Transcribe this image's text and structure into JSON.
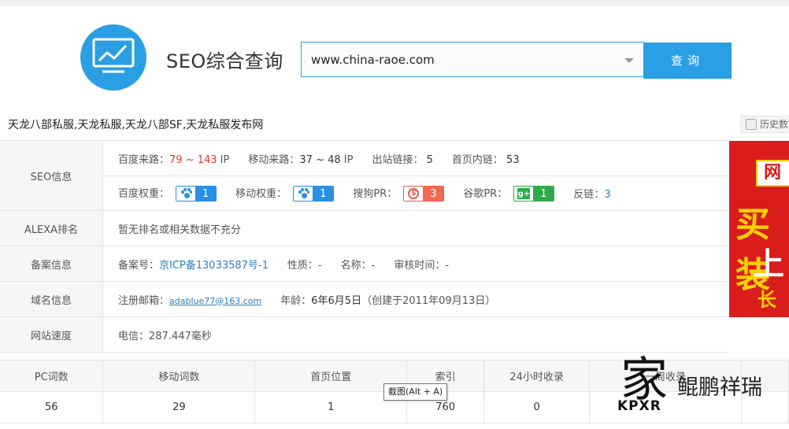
{
  "header": {
    "brand": "SEO综合查询",
    "search_value": "www.china-raoe.com",
    "search_button": "查询"
  },
  "site_title": "天龙八部私服,天龙私服,天龙八部SF,天龙私服发布网",
  "history_label": "历史数",
  "seo": {
    "label": "SEO信息",
    "baidu_traffic_label": "百度来路：",
    "baidu_traffic_value": "79 ~ 143",
    "baidu_traffic_unit": "IP",
    "mobile_traffic_label": "移动来路：",
    "mobile_traffic_value": "37 ~ 48",
    "mobile_traffic_unit": "IP",
    "outbound_label": "出站链接：",
    "outbound_value": "5",
    "internal_label": "首页内链：",
    "internal_value": "53",
    "baidu_weight_label": "百度权重：",
    "baidu_weight_value": "1",
    "mobile_weight_label": "移动权重：",
    "mobile_weight_value": "1",
    "sogou_label": "搜狗PR：",
    "sogou_value": "3",
    "google_label": "谷歌PR：",
    "google_value": "1",
    "backlinks_label": "反链：",
    "backlinks_value": "3"
  },
  "alexa": {
    "label": "ALEXA排名",
    "value": "暂无排名或相关数据不充分"
  },
  "beian": {
    "label": "备案信息",
    "number_label": "备案号：",
    "number_value": "京ICP备13033587号-1",
    "type_label": "性质：",
    "type_value": "-",
    "name_label": "名称：",
    "name_value": "-",
    "review_label": "审核时间：",
    "review_value": "-"
  },
  "domain": {
    "label": "域名信息",
    "email_label": "注册邮箱：",
    "email_value": "adablue77@163.com",
    "age_label": "年龄：",
    "age_value": "6年6月5日",
    "created_value": "（创建于2011年09月13日）"
  },
  "speed": {
    "label": "网站速度",
    "value": "电信：287.447毫秒"
  },
  "ad": {
    "line1": "网",
    "line2": "买装",
    "line3": "上",
    "line4": "长期"
  },
  "stats": {
    "headers": [
      "PC词数",
      "移动词数",
      "首页位置",
      "索引",
      "24小时收录",
      "一周收录",
      ""
    ],
    "values": [
      "56",
      "29",
      "1",
      "760",
      "0",
      "",
      ""
    ]
  },
  "tooltip": "截图(Alt + A)",
  "watermark": {
    "glyph": "家",
    "text": "鲲鹏祥瑞",
    "code": "KPXR"
  },
  "colors": {
    "accent": "#2b9fe3",
    "red": "#e33333",
    "green": "#2eaa4a"
  }
}
